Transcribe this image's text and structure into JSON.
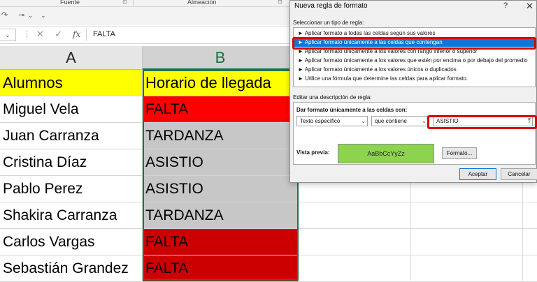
{
  "ribbon": {
    "group_fuente": "Fuente",
    "group_alineacion": "Alineación",
    "launcher_glyph": "⊡"
  },
  "quick_access": {
    "redo_glyph": "↷",
    "paint_glyph": "⊸",
    "dropdown_glyph": "⌄"
  },
  "formula_bar": {
    "namebox_arrow": "⌄",
    "dots": "⋮",
    "cancel_glyph": "✕",
    "enter_glyph": "✓",
    "fx_label": "fx",
    "value": "FALTA"
  },
  "columns": [
    {
      "label": "A"
    },
    {
      "label": "B"
    }
  ],
  "rows": [
    {
      "name": "Alumnos",
      "status": "Horario de llegada",
      "header": true
    },
    {
      "name": "Miguel Vela",
      "status": "FALTA"
    },
    {
      "name": "Juan Carranza",
      "status": "TARDANZA"
    },
    {
      "name": "Cristina Díaz",
      "status": "ASISTIO"
    },
    {
      "name": "Pablo Perez",
      "status": "ASISTIO"
    },
    {
      "name": "Shakira Carranza",
      "status": "TARDANZA"
    },
    {
      "name": "Carlos Vargas",
      "status": "FALTA"
    },
    {
      "name": "Sebastián Grandez",
      "status": "FALTA"
    }
  ],
  "colors": {
    "header_fill": "#ffff00",
    "falta_fill": "#ff0000",
    "falta_fill_dark": "#cc0000",
    "gray_fill": "#c7c7c7",
    "preview_fill": "#8dd44e",
    "selection_blue": "#0b78d6",
    "callout_red": "#d90000",
    "excel_green": "#217346"
  },
  "dialog": {
    "title": "Nueva regla de formato",
    "help": "?",
    "close": "✕",
    "select_type_label": "Seleccionar un tipo de regla:",
    "rule_types": [
      "► Aplicar formato a todas las celdas según sus valores",
      "► Aplicar formato únicamente a las celdas que contengan",
      "► Aplicar formato únicamente a los valores con rango inferior o superior",
      "► Aplicar formato únicamente a los valores que estén por encima o por debajo del promedio",
      "► Aplicar formato únicamente a los valores únicos o duplicados",
      "► Utilice una fórmula que determine las celdas para aplicar formato."
    ],
    "selected_rule_index": 1,
    "edit_desc_label": "Editar una descripción de regla:",
    "format_only_label": "Dar formato únicamente a las celdas con:",
    "condition_type": "Texto específico",
    "operator": "que contiene",
    "value": "ASISTIO",
    "dropdown_arrow": "⌄",
    "pick_icon": "⤒",
    "preview_label": "Vista previa:",
    "preview_text": "AaBbCcYyZz",
    "format_button": "Formato...",
    "accept_button": "Aceptar",
    "cancel_button": "Cancelar"
  }
}
